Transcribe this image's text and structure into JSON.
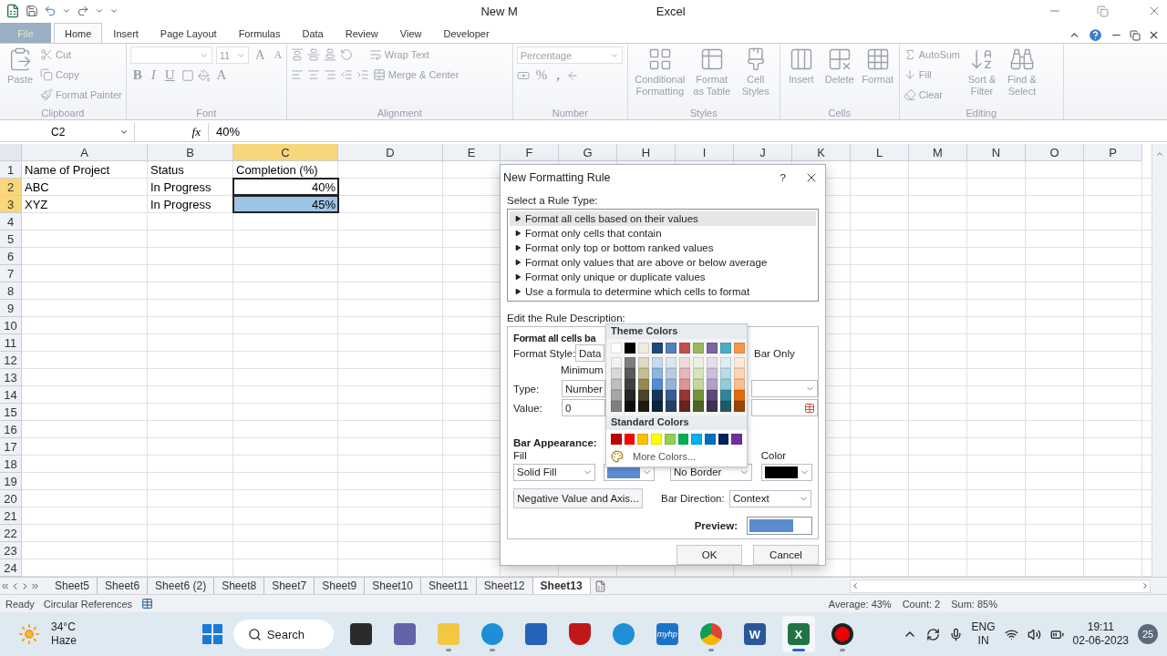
{
  "title_bar": {
    "title_start": "New M",
    "title_end": "Excel"
  },
  "ribbon_tabs": [
    {
      "label": "File",
      "kind": "file",
      "selected": false
    },
    {
      "label": "Home",
      "kind": "tab",
      "selected": true
    },
    {
      "label": "Insert",
      "kind": "tab",
      "selected": false
    },
    {
      "label": "Page Layout",
      "kind": "tab",
      "selected": false
    },
    {
      "label": "Formulas",
      "kind": "tab",
      "selected": false
    },
    {
      "label": "Data",
      "kind": "tab",
      "selected": false
    },
    {
      "label": "Review",
      "kind": "tab",
      "selected": false
    },
    {
      "label": "View",
      "kind": "tab",
      "selected": false
    },
    {
      "label": "Developer",
      "kind": "tab",
      "selected": false
    }
  ],
  "ribbon": {
    "disabled": true,
    "clipboard": {
      "label": "Clipboard",
      "paste": "Paste",
      "cut": "Cut",
      "copy": "Copy",
      "painter": "Format Painter"
    },
    "font": {
      "label": "Font",
      "size": "11",
      "grow": "A",
      "shrink": "A",
      "bold": "B",
      "italic": "I",
      "underline": "U",
      "text_color": "A"
    },
    "alignment": {
      "label": "Alignment",
      "wrap": "Wrap Text",
      "merge": "Merge & Center"
    },
    "number": {
      "label": "Number",
      "format": "Percentage",
      "percent": "%",
      "comma": ","
    },
    "styles": {
      "label": "Styles",
      "buttons": [
        "Conditional Formatting",
        "Format as Table",
        "Cell Styles"
      ]
    },
    "cells": {
      "label": "Cells",
      "buttons": [
        "Insert",
        "Delete",
        "Format"
      ]
    },
    "editing": {
      "label": "Editing",
      "autosum": "AutoSum",
      "fill": "Fill",
      "clear": "Clear",
      "buttons": [
        "Sort & Filter",
        "Find & Select"
      ]
    }
  },
  "formula_bar": {
    "cell": "C2",
    "fx": "fx",
    "value": "40%"
  },
  "columns": [
    {
      "label": "A",
      "selected": false
    },
    {
      "label": "B",
      "selected": false
    },
    {
      "label": "C",
      "selected": true
    },
    {
      "label": "D",
      "selected": false
    },
    {
      "label": "E",
      "selected": false
    },
    {
      "label": "F",
      "selected": false
    },
    {
      "label": "G",
      "selected": false
    },
    {
      "label": "H",
      "selected": false
    },
    {
      "label": "I",
      "selected": false
    },
    {
      "label": "J",
      "selected": false
    },
    {
      "label": "K",
      "selected": false
    },
    {
      "label": "L",
      "selected": false
    },
    {
      "label": "M",
      "selected": false
    },
    {
      "label": "N",
      "selected": false
    },
    {
      "label": "O",
      "selected": false
    },
    {
      "label": "P",
      "selected": false
    }
  ],
  "rows": [
    {
      "number": "1",
      "selected": false,
      "cells": [
        {
          "text": "Name of Project",
          "selected": false
        },
        {
          "text": "Status",
          "selected": false
        },
        {
          "text": "Completion (%)",
          "selected": false
        }
      ]
    },
    {
      "number": "2",
      "selected": true,
      "cells": [
        {
          "text": "ABC",
          "selected": false
        },
        {
          "text": "In Progress",
          "selected": false
        },
        {
          "text": "40%",
          "level": 0,
          "selected": true
        }
      ]
    },
    {
      "number": "3",
      "selected": true,
      "cells": [
        {
          "text": "XYZ",
          "selected": false
        },
        {
          "text": "In Progress",
          "selected": false
        },
        {
          "text": "45%",
          "level": 1,
          "selected": true
        }
      ]
    },
    {
      "number": "4",
      "selected": false
    },
    {
      "number": "5",
      "selected": false
    },
    {
      "number": "6",
      "selected": false
    },
    {
      "number": "7",
      "selected": false
    },
    {
      "number": "8",
      "selected": false
    },
    {
      "number": "9",
      "selected": false
    },
    {
      "number": "10",
      "selected": false
    },
    {
      "number": "11",
      "selected": false
    },
    {
      "number": "12",
      "selected": false
    },
    {
      "number": "13",
      "selected": false
    },
    {
      "number": "14",
      "selected": false
    },
    {
      "number": "15",
      "selected": false
    },
    {
      "number": "16",
      "selected": false
    },
    {
      "number": "17",
      "selected": false
    },
    {
      "number": "18",
      "selected": false
    },
    {
      "number": "19",
      "selected": false
    },
    {
      "number": "20",
      "selected": false
    },
    {
      "number": "21",
      "selected": false
    },
    {
      "number": "22",
      "selected": false
    },
    {
      "number": "23",
      "selected": false
    },
    {
      "number": "24",
      "selected": false
    }
  ],
  "sheet_tabs": [
    {
      "label": "Sheet5",
      "selected": false
    },
    {
      "label": "Sheet6",
      "selected": false
    },
    {
      "label": "Sheet6 (2)",
      "selected": false
    },
    {
      "label": "Sheet8",
      "selected": false
    },
    {
      "label": "Sheet7",
      "selected": false
    },
    {
      "label": "Sheet9",
      "selected": false
    },
    {
      "label": "Sheet10",
      "selected": false
    },
    {
      "label": "Sheet11",
      "selected": false
    },
    {
      "label": "Sheet12",
      "selected": false
    },
    {
      "label": "Sheet13",
      "selected": true
    }
  ],
  "status_bar": {
    "mode": "Ready",
    "circular": "Circular References",
    "average": "Average: 43%",
    "count": "Count: 2",
    "sum": "Sum: 85%"
  },
  "dialog": {
    "title": "New Formatting Rule",
    "help": "?",
    "rule_type_label": "Select a Rule Type:",
    "rule_types": [
      {
        "label": "Format all cells based on their values",
        "selected": true
      },
      {
        "label": "Format only cells that contain",
        "selected": false
      },
      {
        "label": "Format only top or bottom ranked values",
        "selected": false
      },
      {
        "label": "Format only values that are above or below average",
        "selected": false
      },
      {
        "label": "Format only unique or duplicate values",
        "selected": false
      },
      {
        "label": "Use a formula to determine which cells to format",
        "selected": false
      }
    ],
    "description_label": "Edit the Rule Description:",
    "description_heading": "Format all cells ba",
    "format_style_label": "Format Style:",
    "format_style": "Data",
    "bar_only": "Bar Only",
    "minimum_label": "Minimum",
    "type_label": "Type:",
    "min_type": "Number",
    "value_label": "Value:",
    "min_value": "0",
    "bar_appearance_label": "Bar Appearance:",
    "fill_label": "Fill",
    "fill_type": "Solid Fill",
    "border_type": "No Border",
    "border_color_label": "Color",
    "negative_button": "Negative Value and Axis...",
    "bar_direction_label": "Bar Direction:",
    "bar_direction": "Context",
    "preview_label": "Preview:",
    "ok": "OK",
    "cancel": "Cancel",
    "palette": {
      "theme_label": "Theme Colors",
      "theme_colors": [
        {
          "shades": [
            {
              "color": "#ffffff"
            },
            {
              "color": "#f2f2f2"
            },
            {
              "color": "#d9d9d9"
            },
            {
              "color": "#bfbfbf"
            },
            {
              "color": "#a6a6a6"
            },
            {
              "color": "#808080"
            }
          ]
        },
        {
          "shades": [
            {
              "color": "#000000"
            },
            {
              "color": "#7f7f7f"
            },
            {
              "color": "#595959"
            },
            {
              "color": "#404040"
            },
            {
              "color": "#262626"
            },
            {
              "color": "#0d0d0d"
            }
          ]
        },
        {
          "shades": [
            {
              "color": "#eeece1"
            },
            {
              "color": "#ddd9c4"
            },
            {
              "color": "#c4bd97"
            },
            {
              "color": "#948a54"
            },
            {
              "color": "#4a452a"
            },
            {
              "color": "#1d1b10"
            }
          ]
        },
        {
          "shades": [
            {
              "color": "#1f497d"
            },
            {
              "color": "#c6d9f0"
            },
            {
              "color": "#8db4e2"
            },
            {
              "color": "#538dd5"
            },
            {
              "color": "#16365c"
            },
            {
              "color": "#0f243e"
            }
          ]
        },
        {
          "shades": [
            {
              "color": "#4f81bd"
            },
            {
              "color": "#dce6f1"
            },
            {
              "color": "#b8cce4"
            },
            {
              "color": "#95b3d7"
            },
            {
              "color": "#366092"
            },
            {
              "color": "#244062"
            }
          ]
        },
        {
          "shades": [
            {
              "color": "#c0504d"
            },
            {
              "color": "#f2dcdb"
            },
            {
              "color": "#e6b8b7"
            },
            {
              "color": "#da9694"
            },
            {
              "color": "#963634"
            },
            {
              "color": "#632523"
            }
          ]
        },
        {
          "shades": [
            {
              "color": "#9bbb59"
            },
            {
              "color": "#ebf1de"
            },
            {
              "color": "#d8e4bc"
            },
            {
              "color": "#c4d79b"
            },
            {
              "color": "#76933c"
            },
            {
              "color": "#4f6228"
            }
          ]
        },
        {
          "shades": [
            {
              "color": "#8064a2"
            },
            {
              "color": "#e4dfec"
            },
            {
              "color": "#ccc0da"
            },
            {
              "color": "#b1a0c7"
            },
            {
              "color": "#60497a"
            },
            {
              "color": "#403151"
            }
          ]
        },
        {
          "shades": [
            {
              "color": "#4bacc6"
            },
            {
              "color": "#daeef3"
            },
            {
              "color": "#b7dee8"
            },
            {
              "color": "#92cddc"
            },
            {
              "color": "#31869b"
            },
            {
              "color": "#215967"
            }
          ]
        },
        {
          "shades": [
            {
              "color": "#f79646"
            },
            {
              "color": "#fde9d9"
            },
            {
              "color": "#fcd5b4"
            },
            {
              "color": "#fabf8f"
            },
            {
              "color": "#e26b0a"
            },
            {
              "color": "#974706"
            }
          ]
        }
      ],
      "standard_label": "Standard Colors",
      "standard_colors": [
        {
          "color": "#c00000"
        },
        {
          "color": "#ff0000"
        },
        {
          "color": "#ffc000"
        },
        {
          "color": "#ffff00"
        },
        {
          "color": "#92d050"
        },
        {
          "color": "#00b050"
        },
        {
          "color": "#00b0f0"
        },
        {
          "color": "#0070c0"
        },
        {
          "color": "#002060"
        },
        {
          "color": "#7030a0"
        }
      ],
      "more": "More Colors..."
    }
  },
  "taskbar": {
    "temperature": "34°C",
    "weather": "Haze",
    "search": "Search",
    "apps": [
      {
        "kind": "taskview",
        "running": false,
        "selected": false
      },
      {
        "kind": "chat",
        "running": false,
        "selected": false
      },
      {
        "kind": "folder",
        "running": true,
        "selected": false
      },
      {
        "kind": "edge",
        "running": true,
        "selected": false
      },
      {
        "kind": "store",
        "running": false,
        "selected": false
      },
      {
        "kind": "shield",
        "running": false,
        "selected": false
      },
      {
        "kind": "help",
        "running": false,
        "selected": false
      },
      {
        "kind": "myhp",
        "label": "myhp",
        "running": false,
        "selected": false
      },
      {
        "kind": "chrome",
        "running": true,
        "selected": false
      },
      {
        "kind": "word",
        "label": "W",
        "running": false,
        "selected": false
      },
      {
        "kind": "excel",
        "label": "X",
        "running": true,
        "selected": true
      },
      {
        "kind": "record",
        "running": true,
        "selected": false
      }
    ],
    "language": "ENG",
    "region": "IN",
    "time": "19:11",
    "date": "02-06-2023",
    "notifications": "25"
  }
}
